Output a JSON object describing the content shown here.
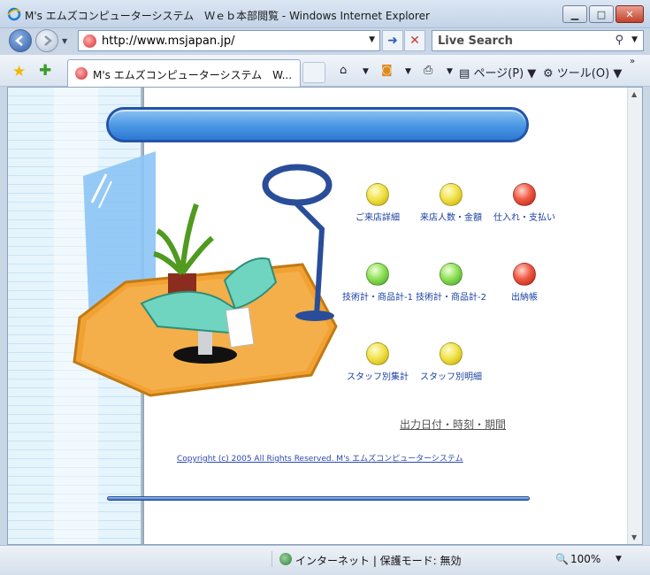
{
  "window": {
    "title": "M's エムズコンピューターシステム　Ｗｅｂ本部閲覧 - Windows Internet Explorer"
  },
  "address_bar": {
    "url": "http://www.msjapan.jp/"
  },
  "search": {
    "placeholder": "Live Search"
  },
  "tab": {
    "label": "M's エムズコンピューターシステム　W..."
  },
  "command_bar": {
    "page_label": "ページ(P)",
    "tools_label": "ツール(O)"
  },
  "page": {
    "menu": [
      {
        "label": "ご来店詳細",
        "color": "yellow"
      },
      {
        "label": "来店人数・金額",
        "color": "yellow"
      },
      {
        "label": "仕入れ・支払い",
        "color": "red"
      },
      {
        "label": "技術計・商品計-1",
        "color": "green"
      },
      {
        "label": "技術計・商品計-2",
        "color": "green"
      },
      {
        "label": "出納帳",
        "color": "red"
      },
      {
        "label": "スタッフ別集計",
        "color": "yellow"
      },
      {
        "label": "スタッフ別明細",
        "color": "yellow"
      }
    ],
    "output_link": "出力日付・時刻・期間",
    "copyright": "Copyright (c) 2005 All Rights Reserved.  M's エムズコンピューターシステム"
  },
  "status_bar": {
    "zone": "インターネット | 保護モード: 無効",
    "zoom": "100%"
  },
  "colors": {
    "banner": "#4d9ae6",
    "link": "#1b3fa0"
  }
}
